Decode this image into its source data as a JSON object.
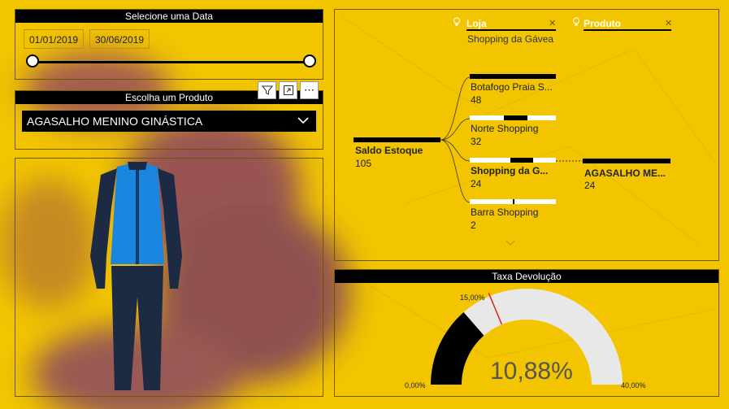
{
  "date_slicer": {
    "title": "Selecione uma Data",
    "start_date": "01/01/2019",
    "end_date": "30/06/2019"
  },
  "product_slicer": {
    "title": "Escolha um Produto",
    "selected": "AGASALHO MENINO GINÁSTICA"
  },
  "visual_toolbar": {
    "icons": [
      "filter-icon",
      "focus-mode-icon",
      "more-options-icon"
    ]
  },
  "product_image": {
    "description_icon": "tracksuit-image"
  },
  "decomposition_tree": {
    "filters": [
      {
        "label": "Loja",
        "value": "Shopping da Gávea"
      },
      {
        "label": "Produto",
        "value": ""
      }
    ],
    "root": {
      "name": "Saldo Estoque",
      "value": "105"
    },
    "stores": [
      {
        "name": "Botafogo Praia S...",
        "value": "48",
        "fill_start": 0.0,
        "fill_end": 1.0,
        "bold": false
      },
      {
        "name": "Norte Shopping",
        "value": "32",
        "fill_start": 0.4,
        "fill_end": 0.67,
        "bold": false
      },
      {
        "name": "Shopping da G...",
        "value": "24",
        "fill_start": 0.47,
        "fill_end": 0.74,
        "bold": true
      },
      {
        "name": "Barra Shopping",
        "value": "2",
        "fill_start": 0.5,
        "fill_end": 0.52,
        "bold": false
      }
    ],
    "product_node": {
      "name": "AGASALHO ME...",
      "value": "24"
    }
  },
  "gauge": {
    "title": "Taxa Devolução",
    "value_label": "10,88%",
    "value": 10.88,
    "min_label": "0,00%",
    "max_label": "40,00%",
    "target_label": "15,00%",
    "min": 0,
    "max": 40,
    "target": 15,
    "colors": {
      "fill": "#000000",
      "track": "#e8e8e8",
      "target": "#d62728"
    }
  },
  "colors": {
    "background": "#f2c500",
    "header": "#000000"
  }
}
